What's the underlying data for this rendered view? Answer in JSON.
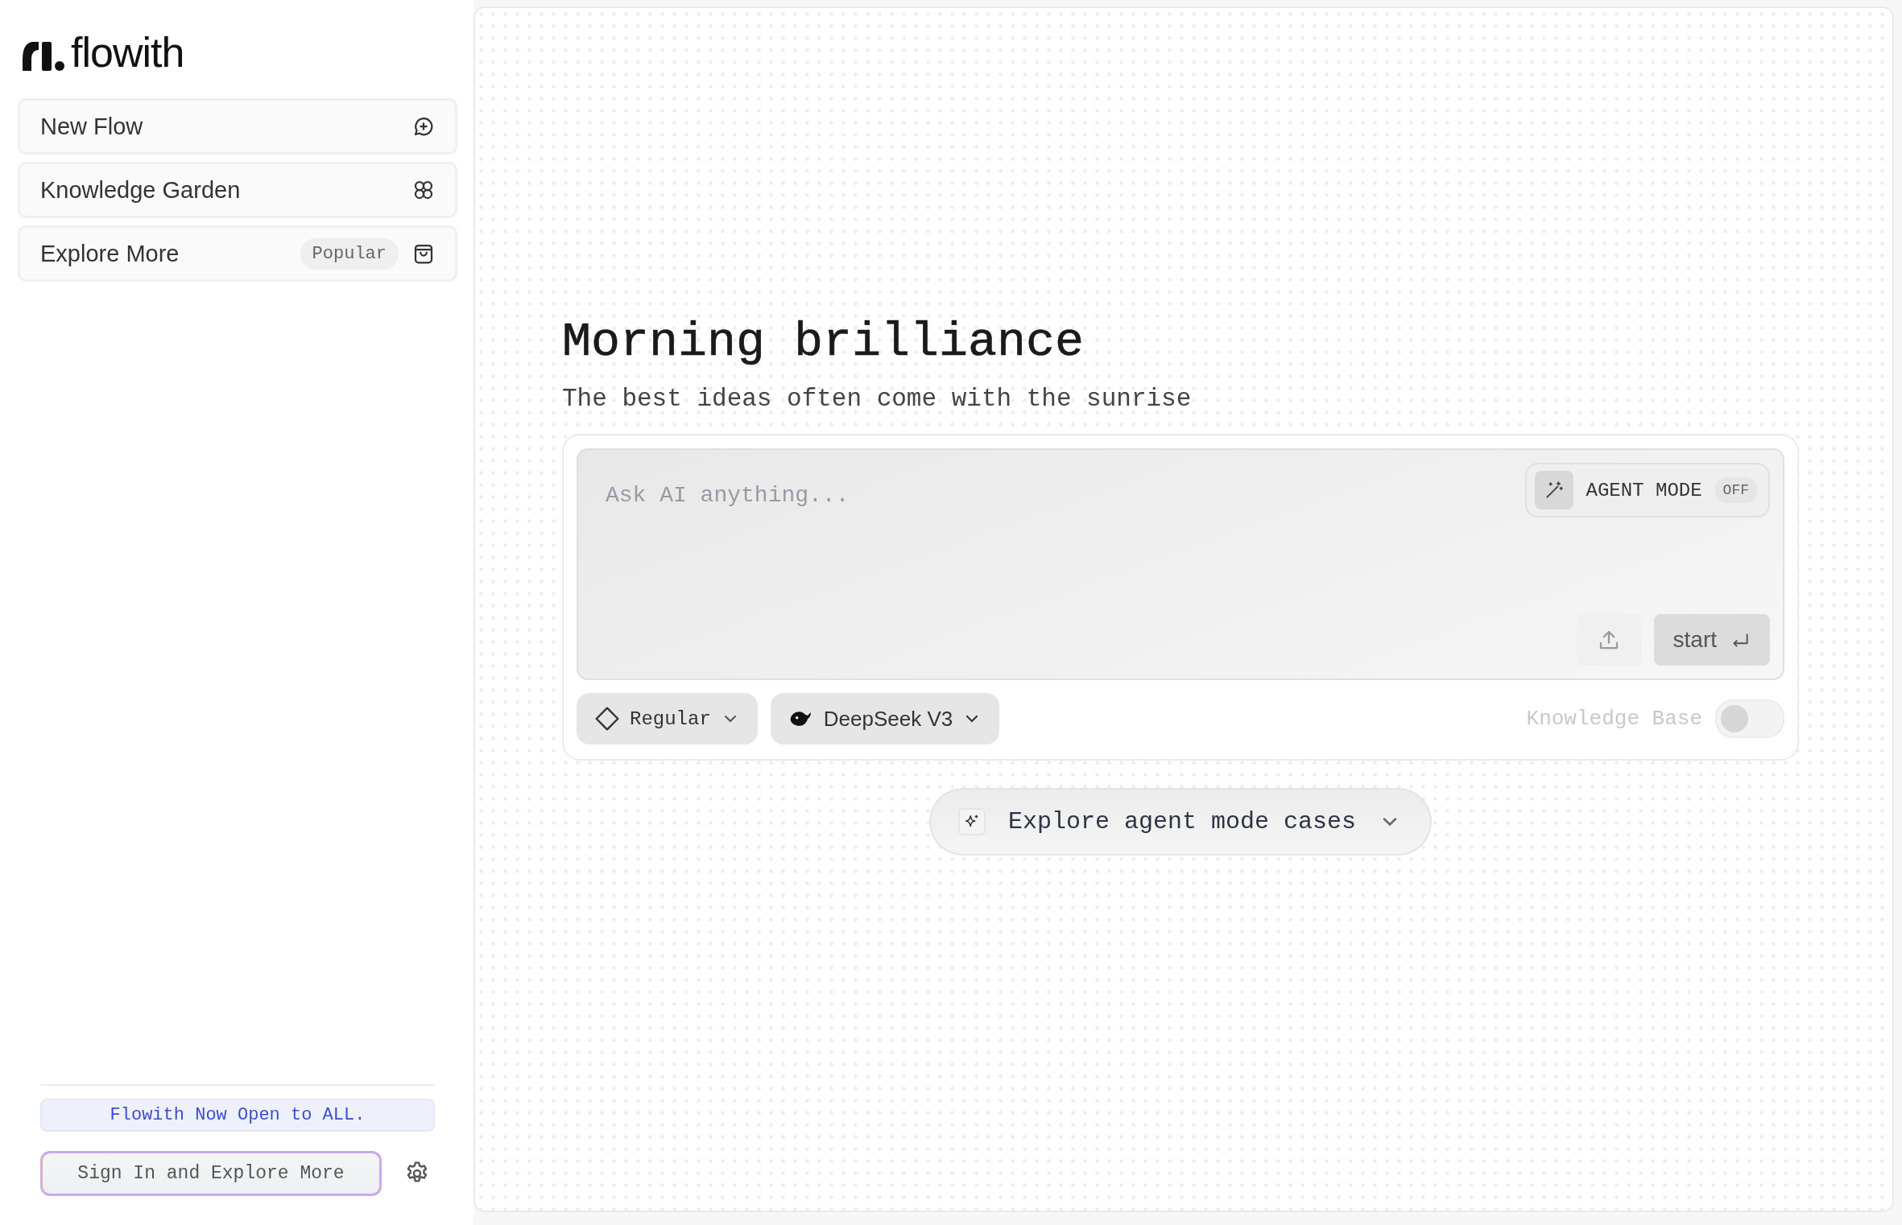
{
  "logo": {
    "text": "flowith"
  },
  "sidebar": {
    "items": [
      {
        "label": "New Flow",
        "kind": "chat-plus"
      },
      {
        "label": "Knowledge Garden",
        "kind": "clover"
      },
      {
        "label": "Explore More",
        "kind": "bag",
        "badge": "Popular"
      }
    ]
  },
  "banner": {
    "text": "Flowith Now Open to ALL."
  },
  "sign_in": {
    "label": "Sign In and Explore More"
  },
  "greeting": {
    "title": "Morning brilliance",
    "subtitle": "The best ideas often come with the sunrise"
  },
  "composer": {
    "placeholder": "Ask AI anything...",
    "agent_mode": {
      "label": "AGENT MODE",
      "state": "OFF",
      "on": false
    },
    "start": {
      "label": "start"
    },
    "mode": {
      "label": "Regular"
    },
    "model": {
      "label": "DeepSeek V3"
    },
    "knowledge_base": {
      "label": "Knowledge Base",
      "on": false
    }
  },
  "explore_cases": {
    "label": "Explore agent mode cases"
  }
}
